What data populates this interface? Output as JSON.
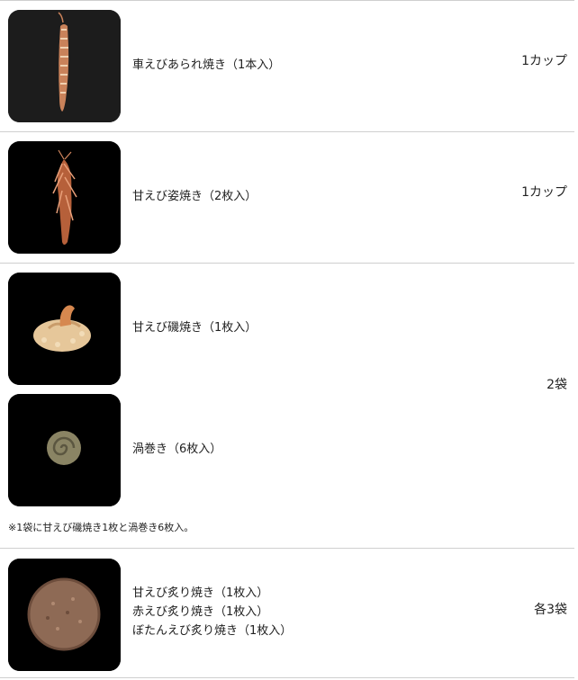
{
  "products": [
    {
      "name": "車えびあられ焼き（1本入）",
      "quantity": "1カップ"
    },
    {
      "name": "甘えび姿焼き（2枚入）",
      "quantity": "1カップ"
    },
    {
      "items": [
        "甘えび磯焼き（1枚入）",
        "渦巻き（6枚入）"
      ],
      "quantity": "2袋",
      "note": "※1袋に甘えび磯焼き1枚と渦巻き6枚入。"
    },
    {
      "items": [
        "甘えび炙り焼き（1枚入）",
        "赤えび炙り焼き（1枚入）",
        "ぼたんえび炙り焼き（1枚入）"
      ],
      "quantity": "各3袋"
    }
  ],
  "colors": {
    "divider": "#cfcfcf",
    "image_bg_1": "#1c1c1c",
    "image_bg": "#000000"
  },
  "icons": [
    "shrimp-arare-image",
    "sweet-shrimp-whole-image",
    "sweet-shrimp-iso-image",
    "uzumaki-image",
    "aburi-senbei-image"
  ]
}
